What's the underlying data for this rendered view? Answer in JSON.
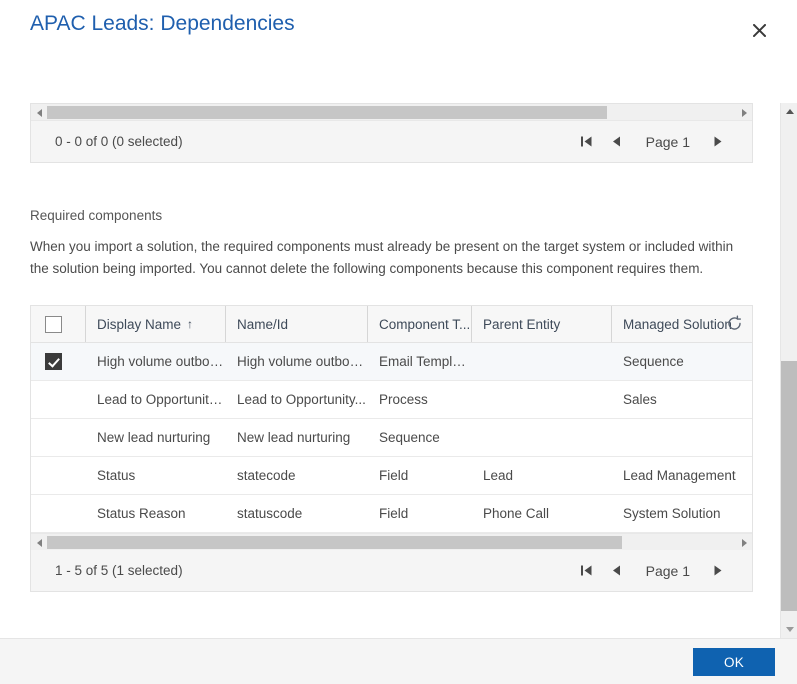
{
  "dialog": {
    "title": "APAC Leads: Dependencies",
    "close_icon": "close-icon"
  },
  "accent_colors": {
    "title_blue": "#1f5fae",
    "primary_button": "#0f62b0",
    "header_bg": "#f7f7f7",
    "selected_row": "#f6f8fa",
    "scroll_thumb": "#bdbdbd"
  },
  "top_grid": {
    "pager": {
      "count_text": "0 - 0 of 0 (0 selected)",
      "first_page_label": "first-page",
      "previous_page_label": "previous-page",
      "page_label": "Page 1",
      "next_page_label": "next-page"
    }
  },
  "required_components": {
    "section_label": "Required components",
    "description": "When you import a solution, the required components must already be present on the target system or included within the solution being imported. You cannot delete the following components because this component requires them.",
    "columns": [
      {
        "label": "Display Name",
        "sort": "↑",
        "sorted": true
      },
      {
        "label": "Name/Id",
        "sort": "",
        "sorted": false
      },
      {
        "label": "Component T...",
        "sort": "",
        "sorted": false
      },
      {
        "label": "Parent Entity",
        "sort": "",
        "sorted": false
      },
      {
        "label": "Managed Solution",
        "sort": "",
        "sorted": false
      }
    ],
    "refresh_icon": "refresh-spinner-icon",
    "rows": [
      {
        "selected": true,
        "display_name": "High volume outbou...",
        "name_id": "High volume outbou...",
        "component_type": "Email Template",
        "parent_entity": "",
        "managed_solution": "Sequence"
      },
      {
        "selected": false,
        "display_name": "Lead to Opportunity...",
        "name_id": "Lead to Opportunity...",
        "component_type": "Process",
        "parent_entity": "",
        "managed_solution": "Sales"
      },
      {
        "selected": false,
        "display_name": "New lead nurturing",
        "name_id": "New lead nurturing",
        "component_type": "Sequence",
        "parent_entity": "",
        "managed_solution": ""
      },
      {
        "selected": false,
        "display_name": "Status",
        "name_id": "statecode",
        "component_type": "Field",
        "parent_entity": "Lead",
        "managed_solution": "Lead Management"
      },
      {
        "selected": false,
        "display_name": "Status Reason",
        "name_id": "statuscode",
        "component_type": "Field",
        "parent_entity": "Phone Call",
        "managed_solution": "System Solution"
      }
    ],
    "pager": {
      "count_text": "1 - 5 of 5 (1 selected)",
      "first_page_label": "first-page",
      "previous_page_label": "previous-page",
      "page_label": "Page 1",
      "next_page_label": "next-page"
    }
  },
  "footer": {
    "ok_label": "OK"
  }
}
